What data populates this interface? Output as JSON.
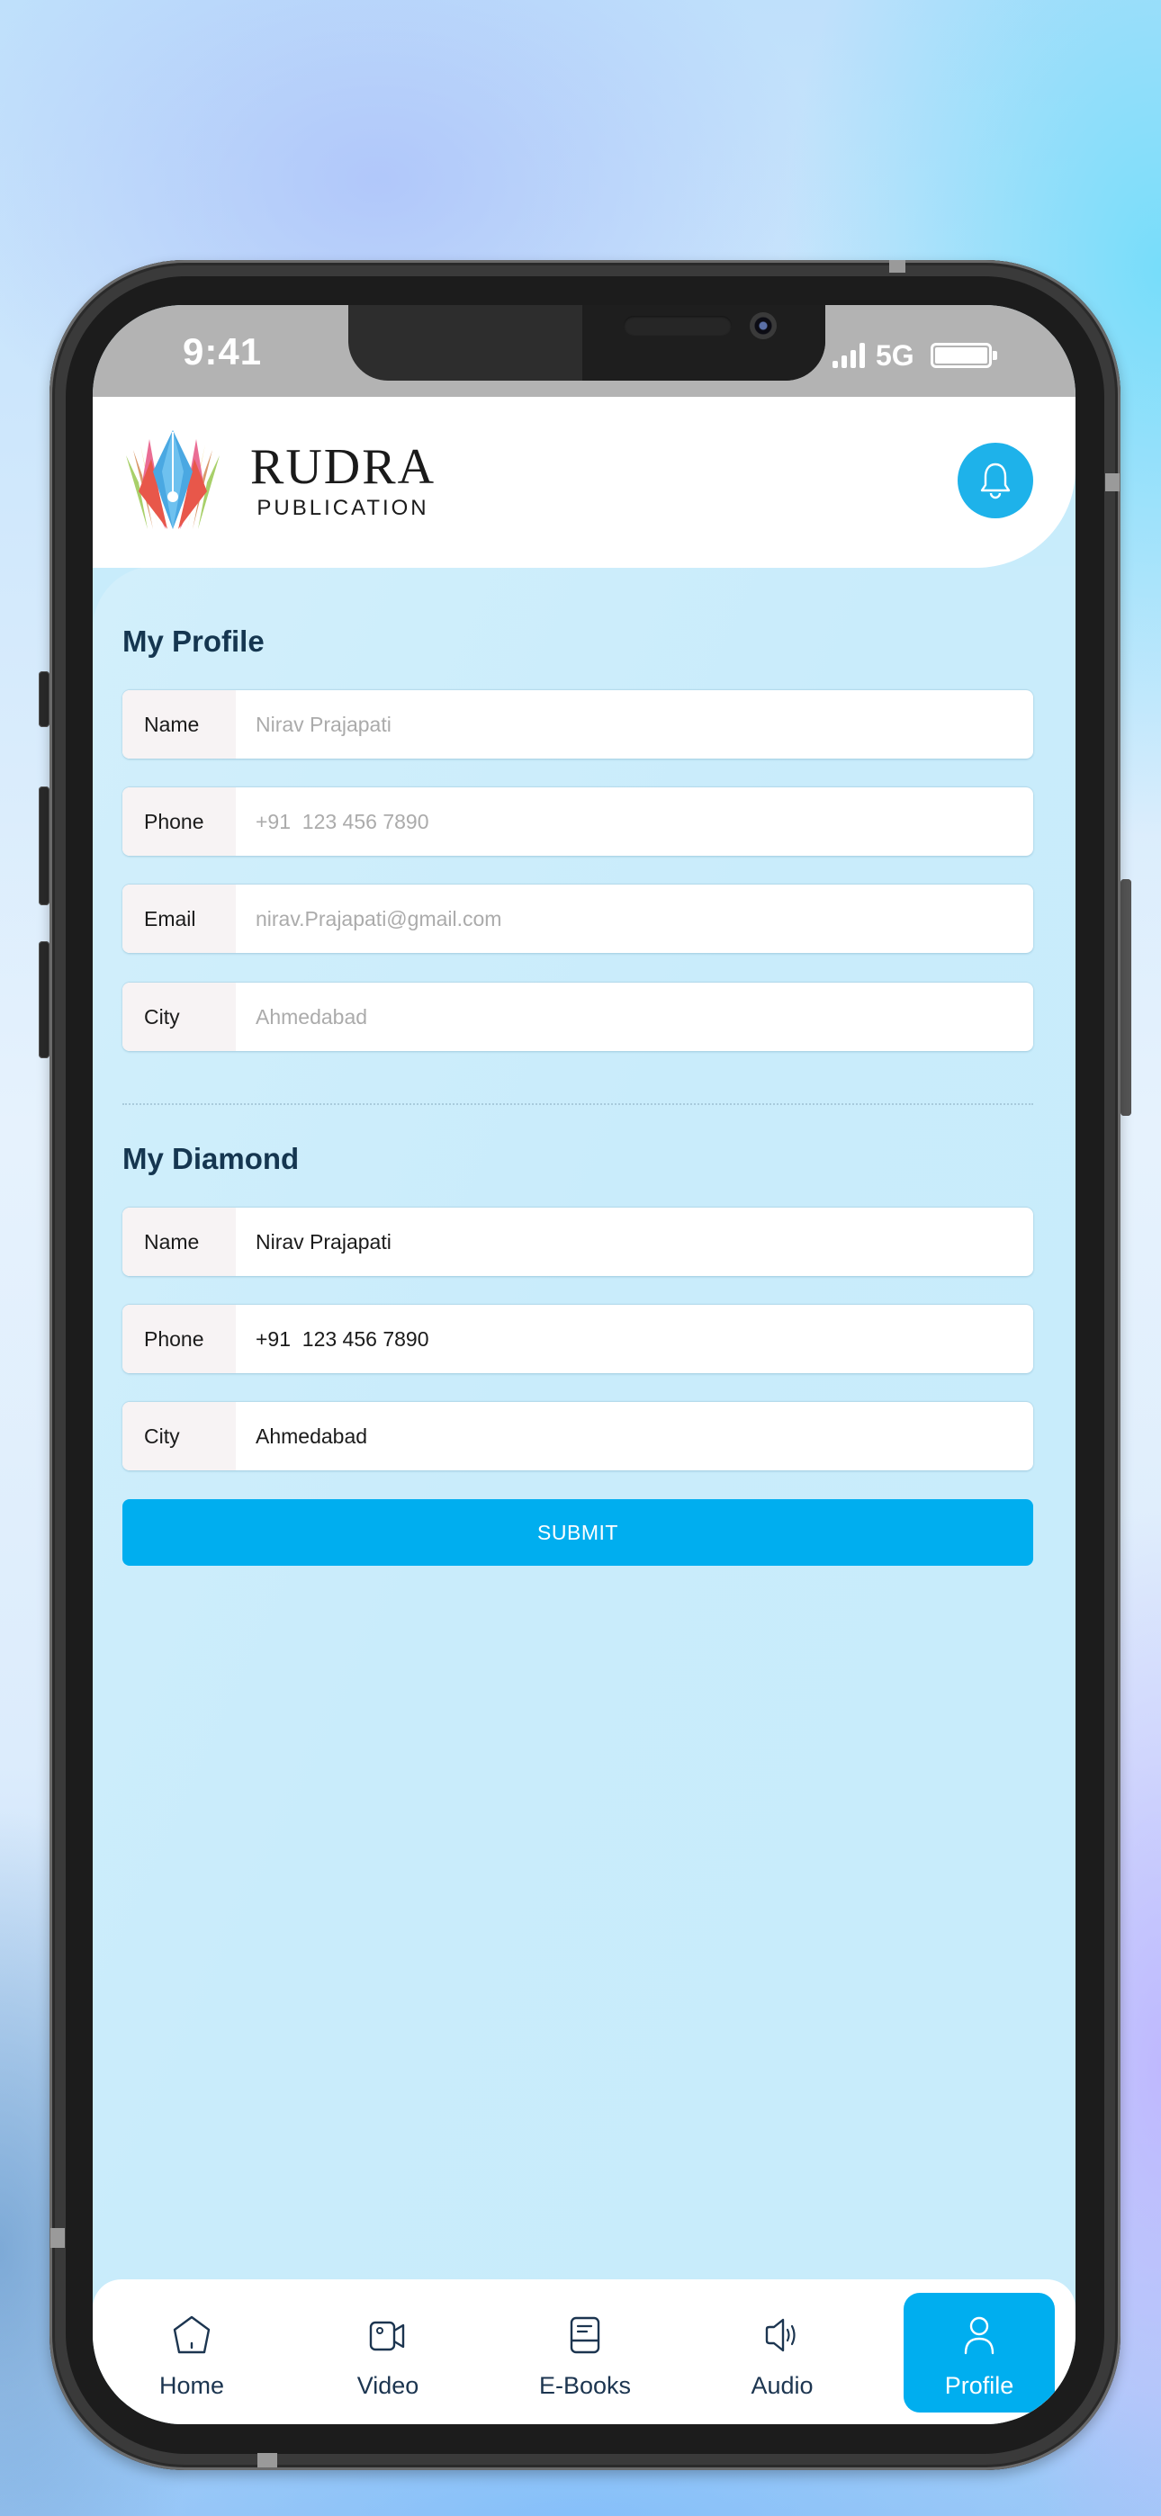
{
  "status_bar": {
    "time": "9:41",
    "network": "5G"
  },
  "header": {
    "brand_title": "RUDRA",
    "brand_subtitle": "PUBLICATION",
    "notification_icon": "bell-icon"
  },
  "my_profile": {
    "title": "My Profile",
    "fields": [
      {
        "label": "Name",
        "placeholder": "Nirav Prajapati",
        "value": ""
      },
      {
        "label": "Phone",
        "placeholder": "+91  123 456 7890",
        "value": ""
      },
      {
        "label": "Email",
        "placeholder": "nirav.Prajapati@gmail.com",
        "value": ""
      },
      {
        "label": "City",
        "placeholder": "Ahmedabad",
        "value": ""
      }
    ]
  },
  "my_diamond": {
    "title": "My Diamond",
    "fields": [
      {
        "label": "Name",
        "value": "Nirav Prajapati"
      },
      {
        "label": "Phone",
        "value": "+91  123 456 7890"
      },
      {
        "label": "City",
        "value": "Ahmedabad"
      }
    ],
    "submit_label": "SUBMIT"
  },
  "bottom_nav": {
    "items": [
      {
        "label": "Home",
        "icon": "home-icon",
        "active": false
      },
      {
        "label": "Video",
        "icon": "video-camera-icon",
        "active": false
      },
      {
        "label": "E-Books",
        "icon": "book-icon",
        "active": false
      },
      {
        "label": "Audio",
        "icon": "speaker-icon",
        "active": false
      },
      {
        "label": "Profile",
        "icon": "user-icon",
        "active": true
      }
    ]
  },
  "colors": {
    "accent": "#00aeef",
    "heading": "#153650",
    "content_bg": "#c8ecfb",
    "status_bar_bg": "#b3b3b3",
    "label_bg": "#f7f3f4",
    "placeholder": "#ababab"
  }
}
